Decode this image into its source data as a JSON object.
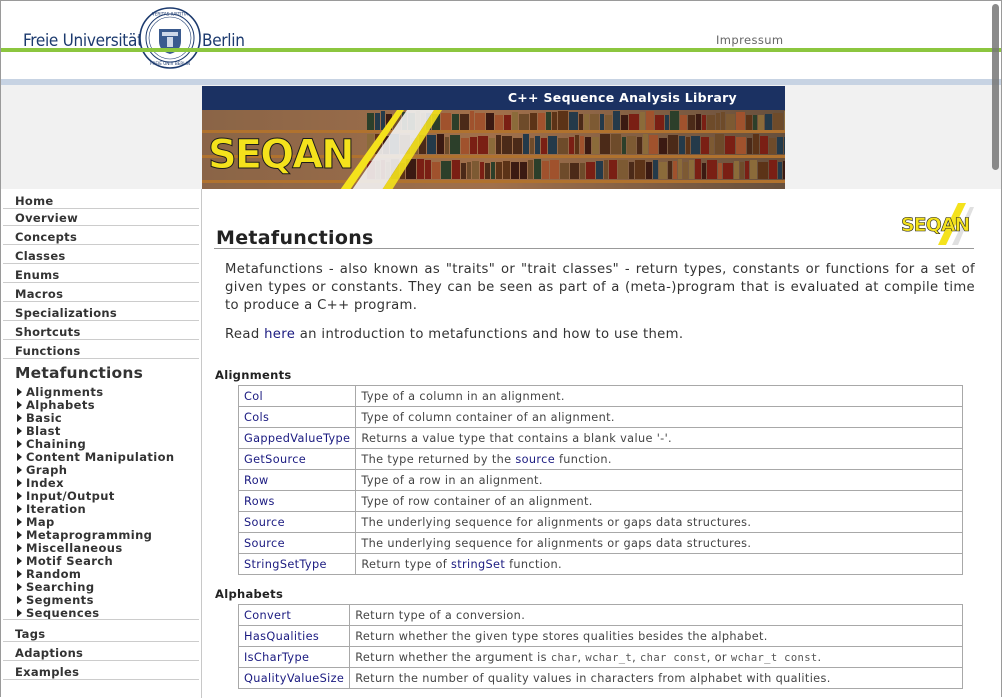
{
  "header": {
    "uni_left": "Freie Universität",
    "uni_right": "Berlin",
    "impressum": "Impressum",
    "seal_text": "VERITAS · IUSTITIA · LIBERTAS · FREIE UNIVERSITÄT BERLIN"
  },
  "banner": {
    "title": "C++ Sequence Analysis Library",
    "logo_text": "SEQAN"
  },
  "sidebar": {
    "top_items": [
      {
        "label": "Home"
      },
      {
        "label": "Overview"
      },
      {
        "label": "Concepts"
      },
      {
        "label": "Classes"
      },
      {
        "label": "Enums"
      },
      {
        "label": "Macros"
      },
      {
        "label": "Specializations"
      },
      {
        "label": "Shortcuts"
      },
      {
        "label": "Functions"
      }
    ],
    "current": "Metafunctions",
    "sub_items": [
      {
        "label": "Alignments"
      },
      {
        "label": "Alphabets"
      },
      {
        "label": "Basic"
      },
      {
        "label": "Blast"
      },
      {
        "label": "Chaining"
      },
      {
        "label": "Content Manipulation"
      },
      {
        "label": "Graph"
      },
      {
        "label": "Index"
      },
      {
        "label": "Input/Output"
      },
      {
        "label": "Iteration"
      },
      {
        "label": "Map"
      },
      {
        "label": "Metaprogramming"
      },
      {
        "label": "Miscellaneous"
      },
      {
        "label": "Motif Search"
      },
      {
        "label": "Random"
      },
      {
        "label": "Searching"
      },
      {
        "label": "Segments"
      },
      {
        "label": "Sequences"
      }
    ],
    "bottom_items": [
      {
        "label": "Tags"
      },
      {
        "label": "Adaptions"
      },
      {
        "label": "Examples"
      }
    ]
  },
  "main": {
    "logo_text": "SEQAN",
    "title": "Metafunctions",
    "intro": "Metafunctions - also known as \"traits\" or \"trait classes\" - return types, constants or functions for a set of given types or constants. They can be seen as part of a (meta-)program that is evaluated at compile time to produce a C++ program.",
    "read_prefix": "Read ",
    "read_link": "here",
    "read_suffix": " an introduction to metafunctions and how to use them.",
    "sections": [
      {
        "heading": "Alignments",
        "rows": [
          {
            "name": "Col",
            "desc": "Type of a column in an alignment."
          },
          {
            "name": "Cols",
            "desc": "Type of column container of an alignment."
          },
          {
            "name": "GappedValueType",
            "desc": "Returns a value type that contains a blank value '-'."
          },
          {
            "name": "GetSource",
            "desc_pre": "The type returned by the ",
            "desc_link": "source",
            "desc_post": " function."
          },
          {
            "name": "Row",
            "desc": "Type of a row in an alignment."
          },
          {
            "name": "Rows",
            "desc": "Type of row container of an alignment."
          },
          {
            "name": "Source",
            "desc": "The underlying sequence for alignments or gaps data structures."
          },
          {
            "name": "Source",
            "desc": "The underlying sequence for alignments or gaps data structures."
          },
          {
            "name": "StringSetType",
            "desc_pre": "Return type of ",
            "desc_link": "stringSet",
            "desc_post": " function."
          }
        ]
      },
      {
        "heading": "Alphabets",
        "rows": [
          {
            "name": "Convert",
            "desc": "Return type of a conversion."
          },
          {
            "name": "HasQualities",
            "desc": "Return whether the given type stores qualities besides the alphabet."
          },
          {
            "name": "IsCharType",
            "desc_pre": "Return whether the argument is ",
            "code1": "char",
            "sep1": ", ",
            "code2": "wchar_t",
            "sep2": ", ",
            "code3": "char const",
            "sep3": ", or ",
            "code4": "wchar_t const",
            "desc_post": "."
          },
          {
            "name": "QualityValueSize",
            "desc": "Return the number of quality values in characters from alphabet with qualities."
          }
        ]
      }
    ]
  },
  "colors": {
    "fu_blue": "#1c3a6e",
    "fu_green": "#8cc63f",
    "banner_navy": "#1b3162",
    "seqan_yellow": "#f4e21c",
    "link": "#1a1a80"
  }
}
